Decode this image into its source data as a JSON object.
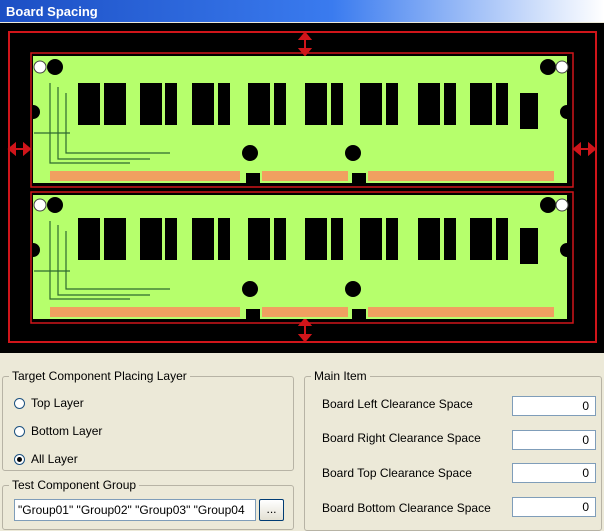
{
  "window": {
    "title": "Board Spacing"
  },
  "colors": {
    "outline": "#d0151a",
    "board": "#b6ff6c",
    "background": "#000000"
  },
  "target_layer": {
    "legend": "Target Component Placing Layer",
    "options": [
      {
        "label": "Top Layer",
        "selected": false
      },
      {
        "label": "Bottom Layer",
        "selected": false
      },
      {
        "label": "All Layer",
        "selected": true
      }
    ]
  },
  "test_group": {
    "legend": "Test Component Group",
    "value": "\"Group01\" \"Group02\" \"Group03\" \"Group04",
    "browse_label": "..."
  },
  "main_item": {
    "legend": "Main Item",
    "fields": [
      {
        "label": "Board Left Clearance Space",
        "value": "0"
      },
      {
        "label": "Board Right Clearance Space",
        "value": "0"
      },
      {
        "label": "Board Top Clearance Space",
        "value": "0"
      },
      {
        "label": "Board Bottom Clearance Space",
        "value": "0"
      }
    ]
  }
}
